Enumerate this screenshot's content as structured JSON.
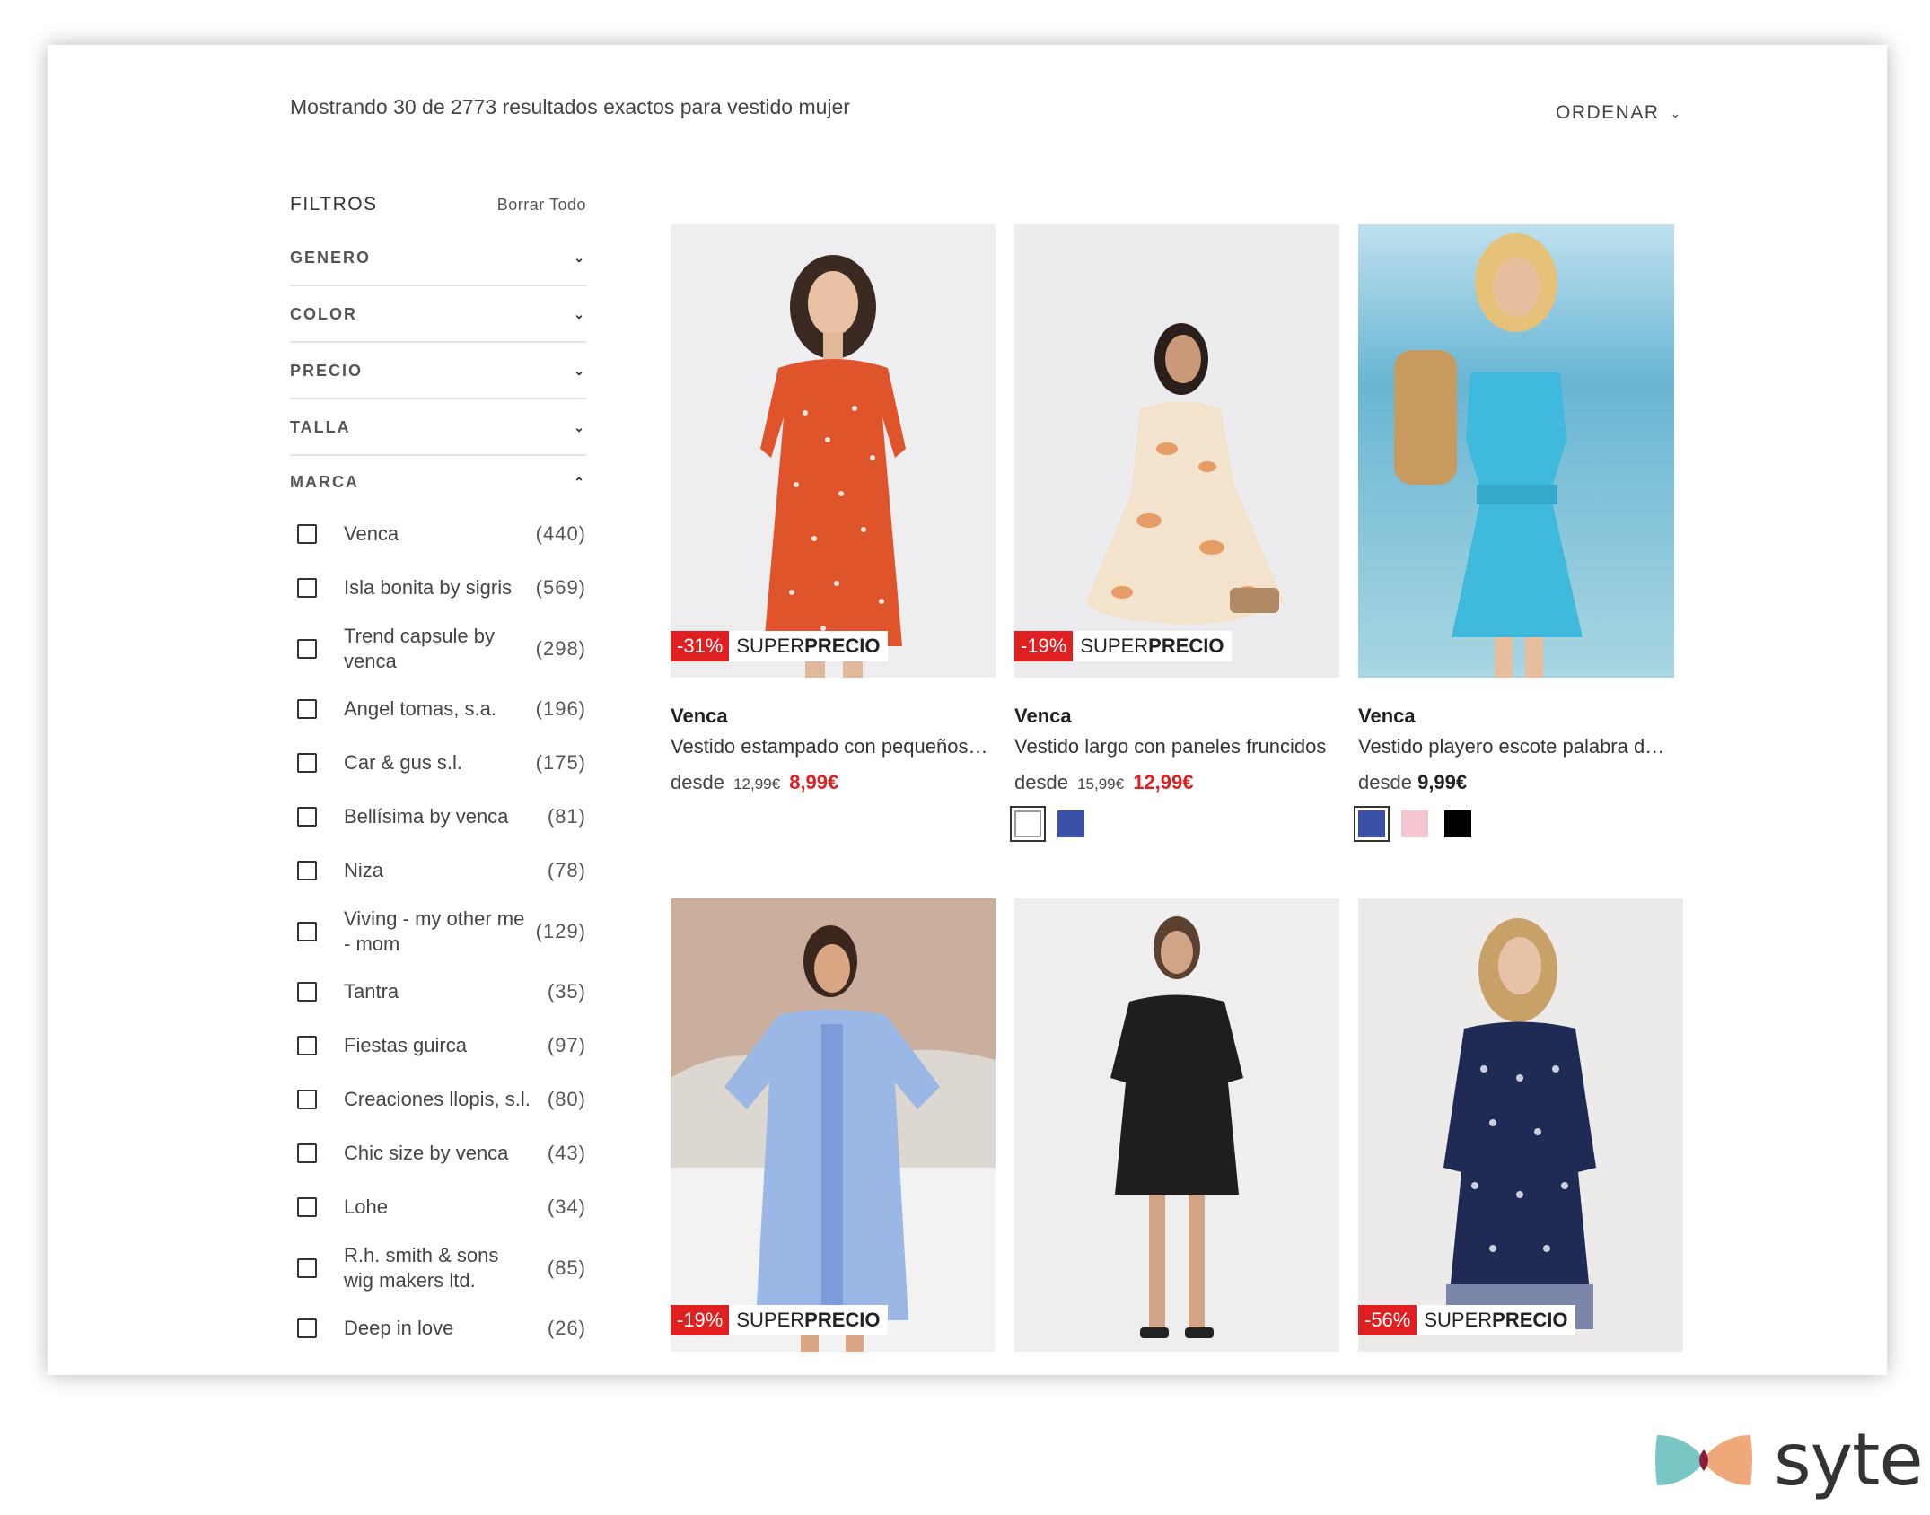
{
  "header": {
    "results_prefix": "Mostrando",
    "shown": "30",
    "of_word": "de",
    "total": "2773",
    "results_suffix": "resultados exactos para vestido mujer",
    "sort_label": "ORDENAR"
  },
  "filters": {
    "title": "FILTROS",
    "clear_all": "Borrar Todo",
    "facets": [
      "GENERO",
      "COLOR",
      "PRECIO",
      "TALLA",
      "MARCA"
    ],
    "brands": [
      {
        "name": "Venca",
        "count": "(440)"
      },
      {
        "name": "Isla bonita by sigris",
        "count": "(569)"
      },
      {
        "name": "Trend capsule by venca",
        "count": "(298)"
      },
      {
        "name": "Angel tomas, s.a.",
        "count": "(196)"
      },
      {
        "name": "Car & gus s.l.",
        "count": "(175)"
      },
      {
        "name": "Bellísima by venca",
        "count": "(81)"
      },
      {
        "name": "Niza",
        "count": "(78)"
      },
      {
        "name": "Viving - my other me - mom",
        "count": "(129)"
      },
      {
        "name": "Tantra",
        "count": "(35)"
      },
      {
        "name": "Fiestas guirca",
        "count": "(97)"
      },
      {
        "name": "Creaciones llopis, s.l.",
        "count": "(80)"
      },
      {
        "name": "Chic size by venca",
        "count": "(43)"
      },
      {
        "name": "Lohe",
        "count": "(34)"
      },
      {
        "name": "R.h. smith & sons wig makers ltd.",
        "count": "(85)"
      },
      {
        "name": "Deep in love",
        "count": "(26)"
      }
    ]
  },
  "badge": {
    "super": "SUPER",
    "precio": "PRECIO"
  },
  "products": [
    {
      "brand": "Venca",
      "desc": "Vestido estampado con pequeños…",
      "from": "desde",
      "old": "12,99€",
      "price": "8,99€",
      "discount": "-31%",
      "swatches": [],
      "image": "orange-floral-dress-photo"
    },
    {
      "brand": "Venca",
      "desc": "Vestido largo con paneles fruncidos",
      "from": "desde",
      "old": "15,99€",
      "price": "12,99€",
      "discount": "-19%",
      "swatches": [
        "#ffffff",
        "#3a4fa8"
      ],
      "image": "floral-maxi-dress-photo"
    },
    {
      "brand": "Venca",
      "desc": "Vestido playero escote palabra de…",
      "from": "desde",
      "old": "",
      "price": "9,99€",
      "discount": "",
      "swatches": [
        "#3a4fa8",
        "#f6c6d0",
        "#000000"
      ],
      "image": "turquoise-beach-dress-photo"
    },
    {
      "discount": "-19%",
      "image": "blue-tunic-dress-photo"
    },
    {
      "discount": "",
      "image": "black-smock-dress-photo"
    },
    {
      "discount": "-56%",
      "image": "navy-print-dress-photo"
    }
  ],
  "logo": {
    "text": "syte"
  },
  "colors": {
    "accent_red": "#e02020",
    "swatch_blue": "#3a4fa8"
  }
}
